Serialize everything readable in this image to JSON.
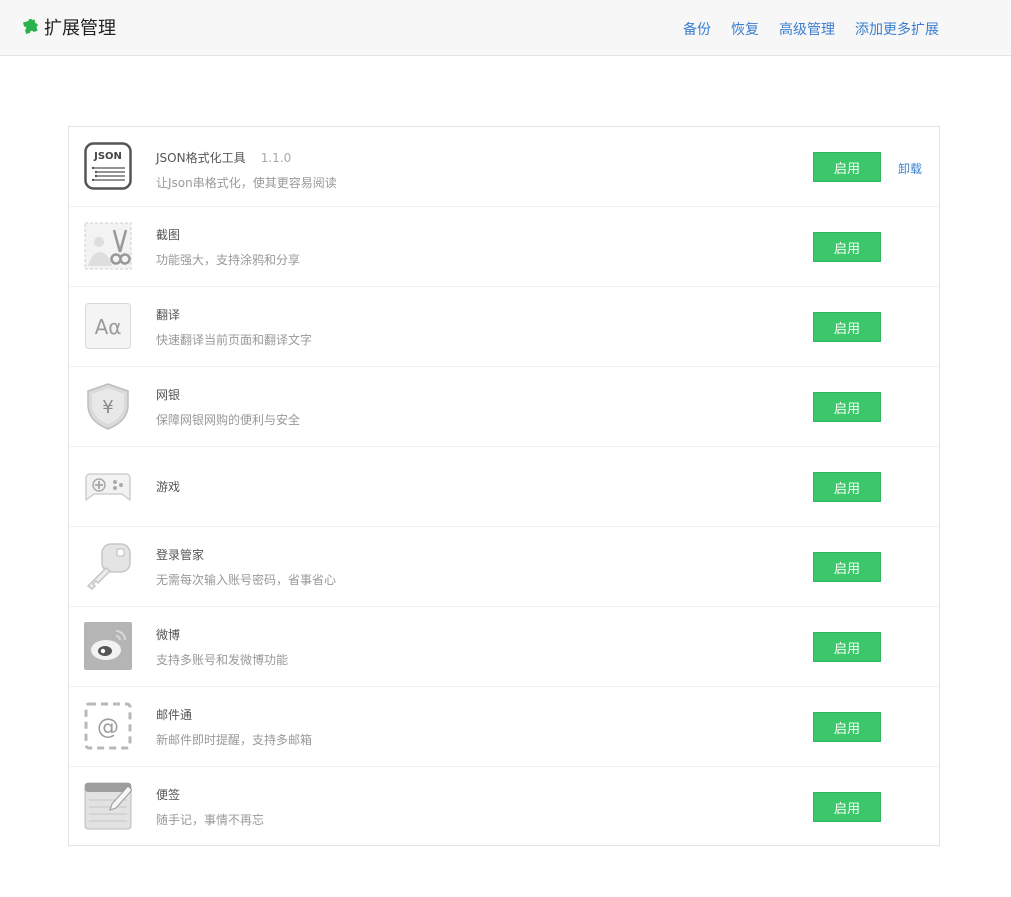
{
  "header": {
    "title": "扩展管理",
    "logo_icon": "puzzle-piece-icon",
    "nav": [
      "备份",
      "恢复",
      "高级管理",
      "添加更多扩展"
    ]
  },
  "extensions": [
    {
      "name": "JSON格式化工具",
      "version": "1.1.0",
      "desc": "让Json串格式化，使其更容易阅读",
      "icon": "json-icon",
      "button": "启用",
      "uninstall": "卸载"
    },
    {
      "name": "截图",
      "desc": "功能强大，支持涂鸦和分享",
      "icon": "screenshot-icon",
      "button": "启用"
    },
    {
      "name": "翻译",
      "desc": "快速翻译当前页面和翻译文字",
      "icon": "translate-icon",
      "button": "启用"
    },
    {
      "name": "网银",
      "desc": "保障网银网购的便利与安全",
      "icon": "shield-yen-icon",
      "button": "启用"
    },
    {
      "name": "游戏",
      "desc": "",
      "icon": "gamepad-icon",
      "button": "启用"
    },
    {
      "name": "登录管家",
      "desc": "无需每次输入账号密码，省事省心",
      "icon": "key-icon",
      "button": "启用"
    },
    {
      "name": "微博",
      "desc": "支持多账号和发微博功能",
      "icon": "weibo-icon",
      "button": "启用"
    },
    {
      "name": "邮件通",
      "desc": "新邮件即时提醒，支持多邮箱",
      "icon": "mail-at-icon",
      "button": "启用"
    },
    {
      "name": "便签",
      "desc": "随手记，事情不再忘",
      "icon": "notepad-icon",
      "button": "启用"
    }
  ],
  "colors": {
    "accent_green": "#3cc76a",
    "link_blue": "#3b7fd0"
  }
}
